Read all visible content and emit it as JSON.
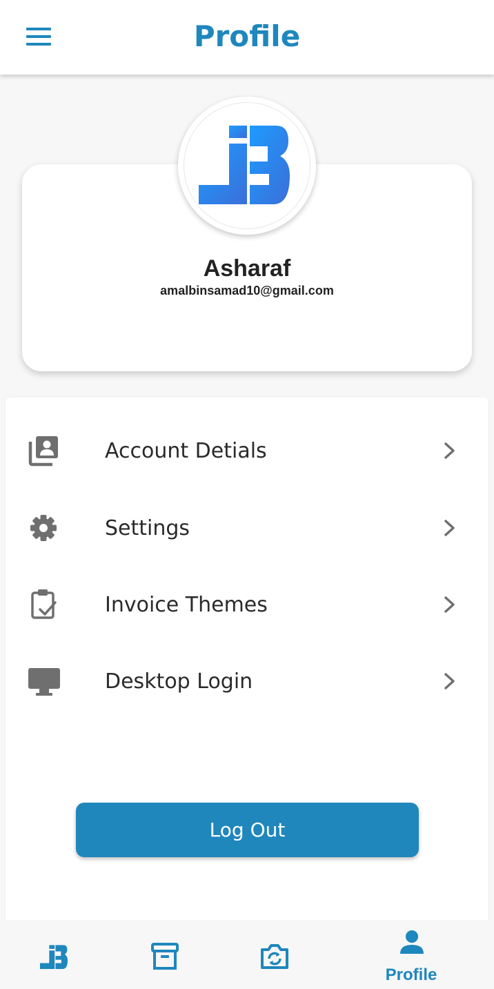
{
  "appbar": {
    "title": "Profile"
  },
  "profile": {
    "name": "Asharaf",
    "email": "amalbinsamad10@gmail.com"
  },
  "menu": {
    "items": [
      {
        "label": "Account Detials",
        "icon": "account-details-icon"
      },
      {
        "label": "Settings",
        "icon": "gear-icon"
      },
      {
        "label": "Invoice Themes",
        "icon": "clipboard-check-icon"
      },
      {
        "label": "Desktop Login",
        "icon": "monitor-icon"
      }
    ]
  },
  "logout": {
    "label": "Log Out"
  },
  "bottom_nav": {
    "items": [
      {
        "icon": "jb-logo-icon",
        "label": ""
      },
      {
        "icon": "archive-icon",
        "label": ""
      },
      {
        "icon": "camera-switch-icon",
        "label": ""
      },
      {
        "icon": "person-icon",
        "label": "Profile"
      }
    ]
  },
  "colors": {
    "accent": "#1e87bd",
    "logo_gradient_start": "#1e9bff",
    "logo_gradient_end": "#3a6fd8",
    "icon_gray": "#6f6f6f"
  }
}
